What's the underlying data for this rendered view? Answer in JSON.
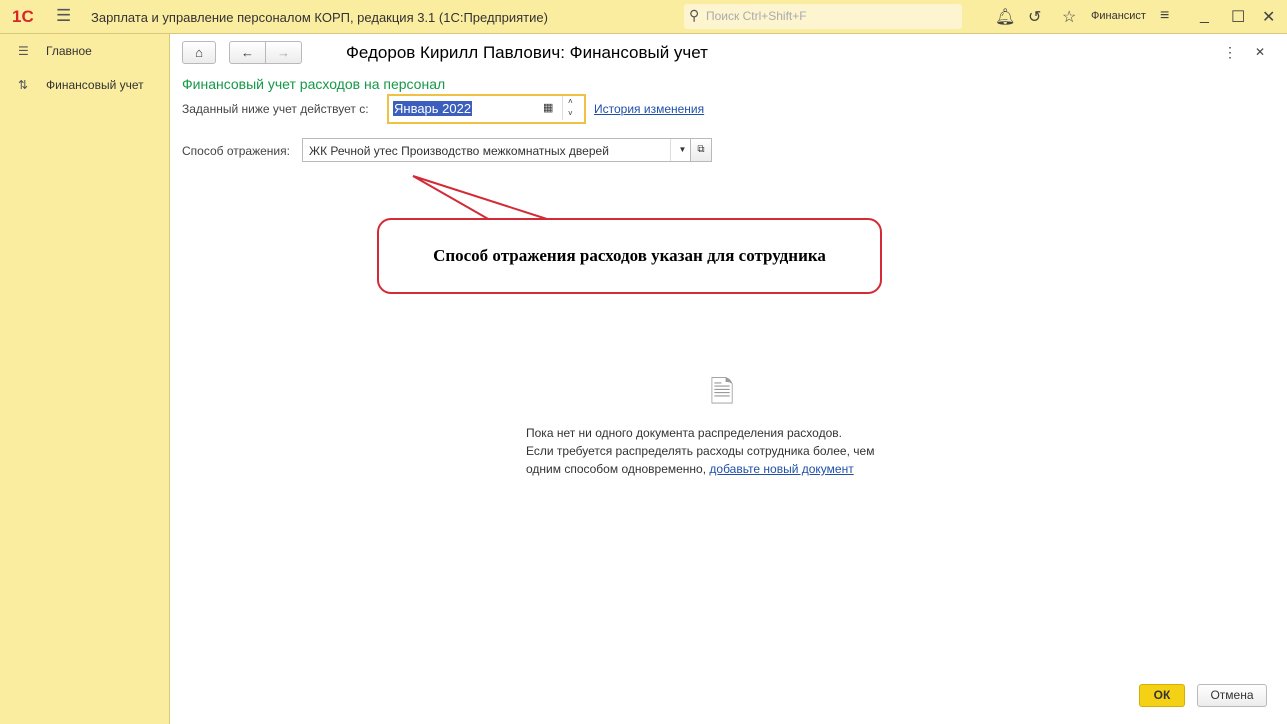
{
  "app": {
    "logo": "1С",
    "title": "Зарплата и управление персоналом КОРП, редакция 3.1  (1С:Предприятие)",
    "search_placeholder": "Поиск Ctrl+Shift+F",
    "user": "Финансист"
  },
  "sidebar": {
    "items": [
      {
        "label": "Главное"
      },
      {
        "label": "Финансовый учет"
      }
    ]
  },
  "form": {
    "title": "Федоров Кирилл Павлович: Финансовый учет",
    "section": "Финансовый учет расходов на персонал",
    "date_label": "Заданный ниже учет действует с:",
    "date_value": "Январь 2022",
    "history_link": "История изменения",
    "method_label": "Способ отражения:",
    "method_value": "ЖК Речной утес Производство межкомнатных дверей"
  },
  "callout": "Способ отражения расходов указан для сотрудника",
  "empty": {
    "line1": "Пока нет ни одного документа распределения расходов.",
    "line2": "Если требуется распределять расходы сотрудника более, чем",
    "line3": "одним способом одновременно,",
    "link": "добавьте новый документ"
  },
  "footer": {
    "ok": "ОК",
    "cancel": "Отмена"
  }
}
